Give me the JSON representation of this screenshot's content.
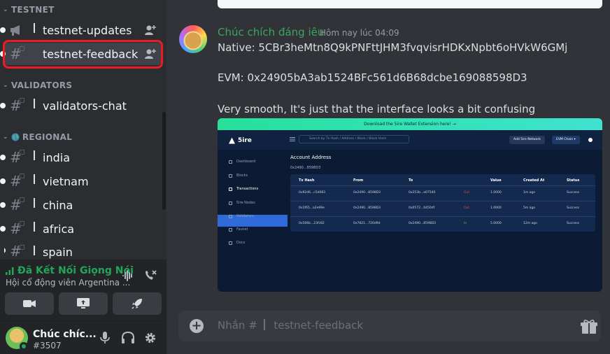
{
  "sidebar": {
    "categories": {
      "testnet": "TESTNET",
      "validators": "VALIDATORS",
      "regional": "REGIONAL"
    },
    "channels": {
      "testnet_updates": "testnet-updates",
      "testnet_feedback": "testnet-feedback",
      "validators_chat": "validators-chat",
      "india": "india",
      "vietnam": "vietnam",
      "china": "china",
      "africa": "africa",
      "spain": "spain"
    }
  },
  "voice": {
    "status": "Đã Kết Nối Giọng Nói",
    "channel": "Hội cổ động viên Argentina ..."
  },
  "user": {
    "name": "Chúc chíc...",
    "tag": "#3507"
  },
  "message": {
    "author": "Chúc chích đáng iêu",
    "time": "Hôm nay lúc 04:09",
    "lines": {
      "native": "Native: 5CBr3heMtn8Q9kPNFttJHM3fvqvisrHDKxNpbt6oHVkW6GMj",
      "evm": "EVM: 0x24905bA3ab1524BFc561d6B68dcbe169088598D3",
      "comment": "Very smooth, It's just that the interface looks a bit confusing"
    }
  },
  "embed": {
    "banner": "Download the 5ire Wallet Extension here!  →",
    "logo": "5ire",
    "search_placeholder": "Search by Tx Hash / Address / Block / Block Hash",
    "add_network": "Add 5ire Network",
    "chain": "EVM Chain ▾",
    "nav": [
      "Dashboard",
      "Blocks",
      "Transactions",
      "5ire Nodes",
      "Validators",
      "Faucet",
      "Docs"
    ],
    "account_title": "Account Address",
    "account_addr": "0x2490...8598D3",
    "columns": [
      "Tx Hash",
      "From",
      "To",
      "Value",
      "Created At",
      "Status"
    ],
    "rows": [
      {
        "hash": "0x92d6...c5d083",
        "from": "0x2490...8598D3",
        "to": "0x253b...a07540",
        "dir": "Out",
        "value": "1.0000",
        "created": "1m ago",
        "status": "Success"
      },
      {
        "hash": "0x1f65...a2e99e",
        "from": "0x2490...8598D3",
        "to": "0x0572...0450df",
        "dir": "Out",
        "value": "1.0000",
        "created": "5m ago",
        "status": "Success"
      },
      {
        "hash": "0x566b...23fc82",
        "from": "0x7821...720d9d",
        "to": "0x2490...8598D3",
        "dir": "In",
        "value": "5.0000",
        "created": "12m ago",
        "status": "Success"
      }
    ]
  },
  "composer": {
    "placeholder_prefix": "Nhắn #",
    "placeholder_channel": "testnet-feedback"
  },
  "colors": {
    "accent_green": "#23a55a",
    "author_green": "#3ba55c",
    "highlight_red": "#ed1c24"
  }
}
